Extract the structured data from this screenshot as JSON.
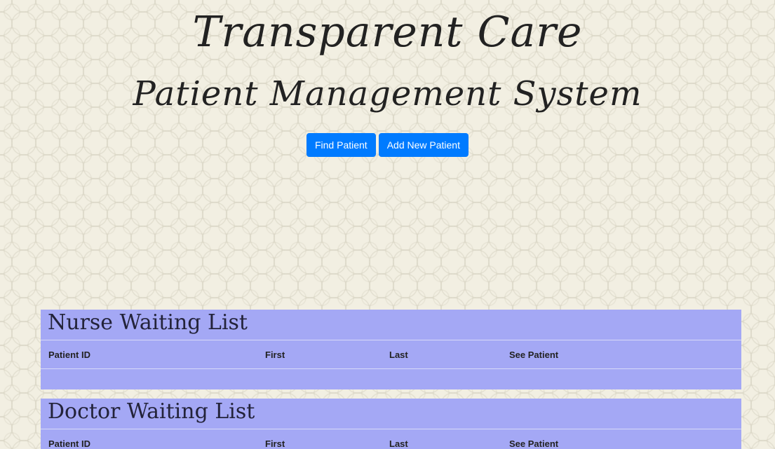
{
  "header": {
    "title": "Transparent Care",
    "subtitle": "Patient Management System"
  },
  "actions": {
    "find_patient": "Find Patient",
    "add_new_patient": "Add New Patient"
  },
  "nurse_list": {
    "title": "Nurse Waiting List",
    "columns": [
      "Patient ID",
      "First",
      "Last",
      "See Patient"
    ],
    "rows": []
  },
  "doctor_list": {
    "title": "Doctor Waiting List",
    "columns": [
      "Patient ID",
      "First",
      "Last",
      "See Patient"
    ],
    "rows": []
  },
  "colors": {
    "button": "#007bff",
    "panel": "#a4a8f5",
    "background": "#f2efe2"
  }
}
